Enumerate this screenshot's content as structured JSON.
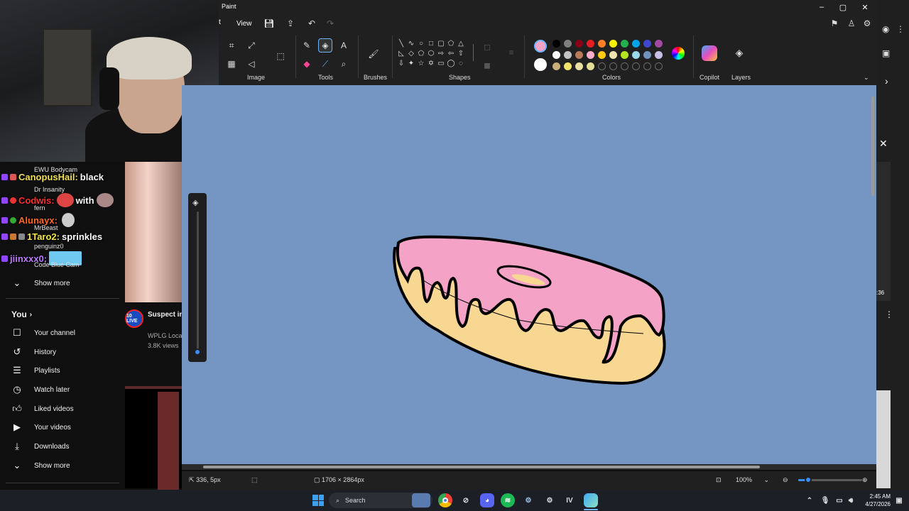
{
  "paint": {
    "app_title": "Paint",
    "menu": {
      "file": "t",
      "view": "View"
    },
    "groups": {
      "image": "Image",
      "tools": "Tools",
      "brushes": "Brushes",
      "shapes": "Shapes",
      "colors": "Colors",
      "copilot": "Copilot",
      "layers": "Layers"
    },
    "colors": {
      "primary": "#f4a3c7",
      "secondary": "#ffffff",
      "row1": [
        "#000000",
        "#7f7f7f",
        "#880015",
        "#ed1c24",
        "#ff7f27",
        "#fff200",
        "#22b14c",
        "#00a2e8",
        "#3f48cc",
        "#a349a4"
      ],
      "row2": [
        "#ffffff",
        "#c3c3c3",
        "#b97a57",
        "#ffaec9",
        "#ffc90e",
        "#efe4b0",
        "#b5e61d",
        "#99d9ea",
        "#7092be",
        "#c8bfe7"
      ],
      "row3": [
        "#c8b07a",
        "#f4e36a",
        "#e8e0a0",
        "#e4df96",
        "",
        "",
        "",
        "",
        "",
        ""
      ]
    },
    "canvas": {
      "background": "#7595c3",
      "donut_icing": "#f4a3c7",
      "donut_dough": "#f7d791"
    },
    "status": {
      "cursor_pos": "336, 5px",
      "canvas_size": "1706 × 2864px",
      "zoom": "100%"
    },
    "zoom_level": 0.15
  },
  "chat": [
    {
      "name": "CanopusHail:",
      "message": "black",
      "name_color": "#f0e05a",
      "sub": "EWU Bodycam"
    },
    {
      "name": "Codwis:",
      "message": "with",
      "name_color": "#ff3030",
      "sub": "Dr Insanity"
    },
    {
      "name": "Alunayx:",
      "message": "",
      "name_color": "#ff6a2a",
      "sub": "fern"
    },
    {
      "name": "1Taro2:",
      "message": "sprinkles",
      "name_color": "#f7e84a",
      "sub": "MrBeast"
    },
    {
      "name": "jiinxxx0:",
      "message": "",
      "name_color": "#c07bff",
      "sub": "penguinz0"
    }
  ],
  "chat_extra_sub": "Code Blue Cam",
  "youtube": {
    "show_more_1": "Show more",
    "you": "You",
    "items": [
      "Your channel",
      "History",
      "Playlists",
      "Watch later",
      "Liked videos",
      "Your videos",
      "Downloads"
    ],
    "show_more_2": "Show more",
    "news_title": "Suspect in writings to",
    "news_channel": "WPLG Loca",
    "news_views": "3.8K views",
    "news_logo": "10 LIVE"
  },
  "taskbar": {
    "search_placeholder": "Search",
    "time": "2:45 AM",
    "date": "4/27/2026",
    "iv_label": "IV"
  },
  "browser": {
    "right_time_badge": ":36"
  }
}
